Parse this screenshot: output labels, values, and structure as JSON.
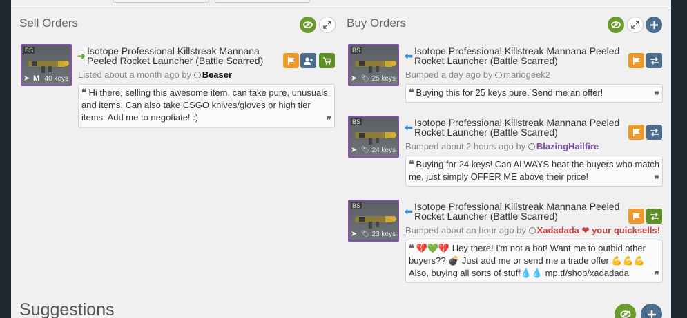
{
  "sell": {
    "title": "Sell Orders",
    "listing": {
      "quality": "BS",
      "price": "40 keys",
      "marker": "M",
      "title_line1": "Isotope Professional Killstreak Mannana",
      "title_line2": "Peeled Rocket Launcher (Battle Scarred)",
      "meta_prefix": "Listed about a month ago by",
      "user": "Beaser",
      "message": "Hi there, selling this awesome item, can take pure, unusuals, and items. Can also take CSGO knives/gloves or high tier items. Add me to negotiate! :)"
    }
  },
  "buy": {
    "title": "Buy Orders",
    "listings": [
      {
        "quality": "BS",
        "price": "25 keys",
        "title_line1": "Isotope Professional Killstreak Mannana Peeled",
        "title_line2": "Rocket Launcher (Battle Scarred)",
        "meta_prefix": "Bumped a day ago by",
        "user": "mariogeek2",
        "message": "Buying this for 25 keys pure. Send me an offer!"
      },
      {
        "quality": "BS",
        "price": "24 keys",
        "title_line1": "Isotope Professional Killstreak Mannana Peeled",
        "title_line2": "Rocket Launcher (Battle Scarred)",
        "meta_prefix": "Bumped about 2 hours ago by",
        "user": "BlazingHailfire",
        "message": "Buying for 24 keys! Can ALWAYS beat the buyers who match me, just simply OFFER ME above their price!"
      },
      {
        "quality": "BS",
        "price": "23 keys",
        "title_line1": "Isotope Professional Killstreak Mannana Peeled",
        "title_line2": "Rocket Launcher (Battle Scarred)",
        "meta_prefix": "Bumped about an hour ago by",
        "user": "Xadadada ❤ your quicksells!",
        "message": "💔💚💔 Hey there! I'm not a bot! Want me to outbid other buyers?? 💣 Just add me or send me a trade offer 💪💪💪 Also, buying all sorts of stuff💧💧 mp.tf/shop/xadadada"
      }
    ]
  },
  "suggestions": {
    "title": "Suggestions"
  },
  "icons": {
    "eye": "eye-icon",
    "expand": "expand-icon",
    "plus": "plus-icon",
    "flag": "flag-icon",
    "add_friend": "add-friend-icon",
    "cart": "cart-icon",
    "exchange": "exchange-icon",
    "quote": "quote-icon"
  },
  "colors": {
    "green": "#6a9b2c",
    "orange": "#ec9a2e",
    "slate": "#4b6c8c",
    "purple_border": "#8650ac",
    "user_purple": "#7d4fa6",
    "user_red": "#c5413f"
  }
}
